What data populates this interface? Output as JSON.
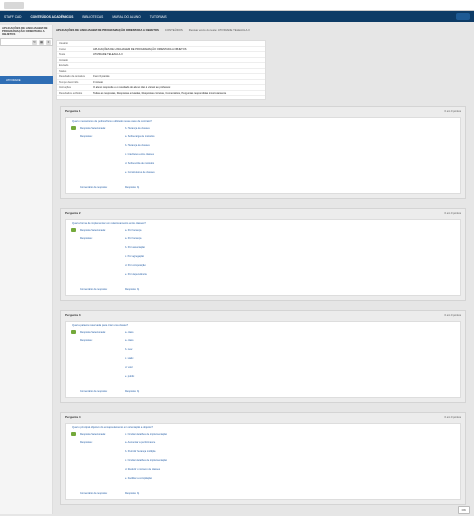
{
  "nav": {
    "items": [
      "STAFF CAD",
      "CONTEÚDOS ACADÊMICOS",
      "BIBLIOTECAS",
      "MURAL DO ALUNO",
      "TUTORIAIS"
    ]
  },
  "sidebar": {
    "course": "APLICAÇÕES DE LINGUAGEM DE PROGRAMAÇÃO ORIENTADA A OBJETOS",
    "link": "ATIVIDADE"
  },
  "breadcrumb": {
    "course": "APLICAÇÕES DE LINGUAGEM DE PROGRAMAÇÃO ORIENTADA A OBJETOS",
    "section": "CONTEÚDOS",
    "item": "Revisar envio do teste: ATIVIDADE TELEAULA II"
  },
  "info": [
    {
      "k": "Usuário",
      "v": ""
    },
    {
      "k": "Curso",
      "v": "APLICAÇÕES DE LINGUAGEM DE PROGRAMAÇÃO ORIENTADA A OBJETOS"
    },
    {
      "k": "Teste",
      "v": "ATIVIDADE TELEAULA II"
    },
    {
      "k": "Iniciado",
      "v": ""
    },
    {
      "k": "Enviado",
      "v": ""
    },
    {
      "k": "Status",
      "v": ""
    },
    {
      "k": "Resultado da tentativa",
      "v": "0 em 0 pontos"
    },
    {
      "k": "Tempo decorrido",
      "v": "0 minuto"
    },
    {
      "k": "Instruções",
      "v": "O aluno responde e o resultado do aluno não é visível ao professor."
    },
    {
      "k": "Resultados exibidos",
      "v": "Todas as respostas, Respostas enviadas, Respostas corretas, Comentários, Perguntas respondidas incorretamente"
    }
  ],
  "labels": {
    "selected": "Resposta Selecionada:",
    "answers": "Respostas:",
    "feedback": "Comentário da resposta:",
    "feedback_value": "Resposta: b)"
  },
  "questions": [
    {
      "title": "Pergunta 1",
      "score": "0 em 0 pontos",
      "stem": "Qual o mecanismo de polimorfismo utilizado nesse caso de contrato?",
      "selected": "b. Herança de classes",
      "options": [
        "a. Sobrecarga de métodos",
        "b. Herança de classes",
        "c. Interfaces entre classes",
        "d. Sobrescrita de métodos",
        "e. Construtores de classes"
      ]
    },
    {
      "title": "Pergunta 2",
      "score": "0 em 0 pontos",
      "stem": "Qual a forma de implementar um relacionamento entre classes?",
      "selected": "a. Por herança",
      "options": [
        "a. Por herança",
        "b. Por associação",
        "c. Por agregação",
        "d. Por composição",
        "e. Por dependência"
      ]
    },
    {
      "title": "Pergunta 3",
      "score": "0 em 0 pontos",
      "stem": "Qual a palavra reservada para criar uma classe?",
      "selected": "a. class",
      "options": [
        "a. class",
        "b. new",
        "c. static",
        "d. void",
        "e. public"
      ]
    },
    {
      "title": "Pergunta 4",
      "score": "0 em 0 pontos",
      "stem": "Qual o principal objetivo do encapsulamento em orientação a objetos?",
      "selected": "c. Ocultar detalhes de implementação",
      "options": [
        "a. Aumentar a performance",
        "b. Permitir herança múltipla",
        "c. Ocultar detalhes de implementação",
        "d. Reduzir o número de classes",
        "e. Facilitar a compilação"
      ]
    }
  ],
  "footer": {
    "ok": "OK"
  }
}
